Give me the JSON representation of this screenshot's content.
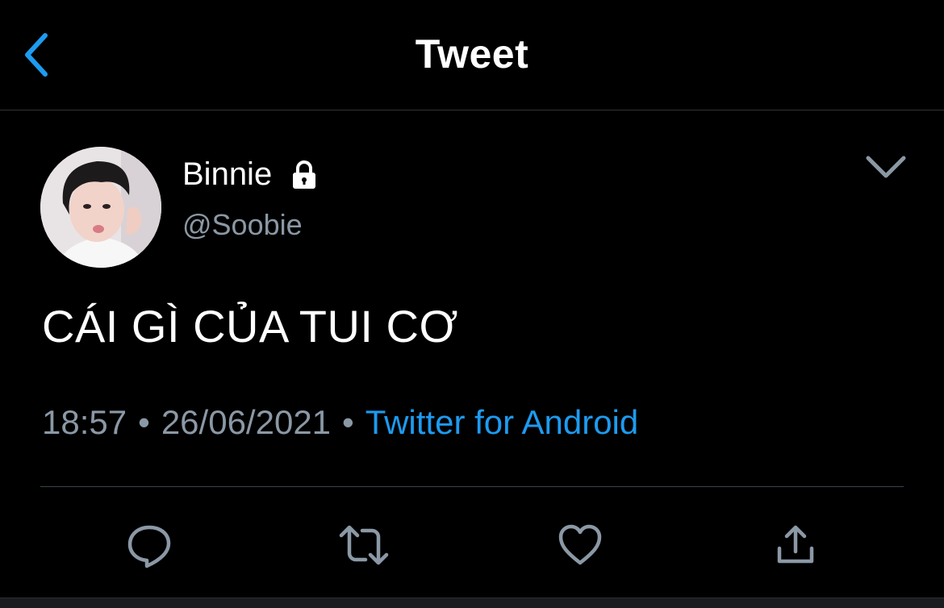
{
  "header": {
    "title": "Tweet",
    "back_icon": "chevron-left-icon",
    "accent": "#1d9bf0"
  },
  "tweet": {
    "author_name": "Binnie",
    "author_handle": "@Soobie",
    "protected_icon": "lock-icon",
    "menu_icon": "chevron-down-icon",
    "text": "CÁI GÌ CỦA TUI CƠ",
    "time": "18:57",
    "date": "26/06/2021",
    "separator": "•",
    "source": "Twitter for Android"
  },
  "actions": [
    {
      "icon": "reply-icon"
    },
    {
      "icon": "retweet-icon"
    },
    {
      "icon": "like-icon"
    },
    {
      "icon": "share-icon"
    }
  ],
  "colors": {
    "background": "#000000",
    "secondary_text": "#8b98a5",
    "link": "#1d9bf0",
    "divider": "#38444d"
  }
}
